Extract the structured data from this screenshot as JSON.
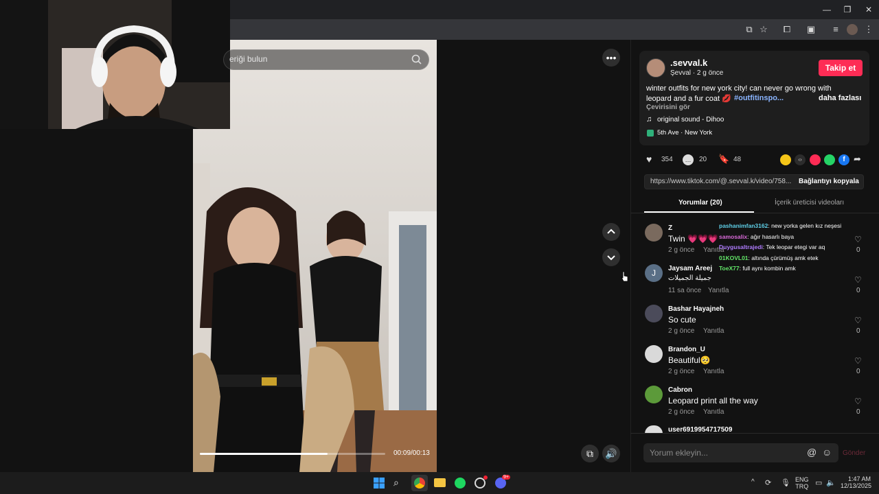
{
  "window": {
    "minimize": "—",
    "restore": "❐",
    "close": "✕"
  },
  "search": {
    "placeholder": "eriği bulun"
  },
  "video": {
    "time": "00:09/00:13",
    "progress": 0.69
  },
  "author": {
    "username": ".sevval.k",
    "display": "Şevval · 2 g önce",
    "follow": "Takip et",
    "caption_line1": "winter outfits for new york city! can never go wrong with",
    "caption_line2": "leopard and a fur coat 💋",
    "hashtag": "#outfitinspo...",
    "more": "daha fazlası",
    "translate": "Çevirisini gör",
    "sound": "original sound - Dihoo",
    "location": "5th Ave · New York"
  },
  "stats": {
    "likes": "354",
    "comments": "20",
    "saves": "48"
  },
  "link": {
    "url": "https://www.tiktok.com/@.sevval.k/video/758...",
    "copy": "Bağlantıyı kopyala"
  },
  "tabs": {
    "comments": "Yorumlar (20)",
    "creator": "İçerik üreticisi videoları"
  },
  "comments": [
    {
      "name": "Z",
      "text": "Twin 💗💗💗",
      "time": "2 g önce",
      "reply": "Yanıtla",
      "likes": "0"
    },
    {
      "name": "Jaysam Areej",
      "text": "جميلة الجميلات",
      "time": "11 sa önce",
      "reply": "Yanıtla",
      "likes": "0",
      "initial": "J"
    },
    {
      "name": "Bashar Hayajneh",
      "text": "So cute",
      "time": "2 g önce",
      "reply": "Yanıtla",
      "likes": "0"
    },
    {
      "name": "Brandon_U",
      "text": "Beautiful🥺",
      "time": "2 g önce",
      "reply": "Yanıtla",
      "likes": "0"
    },
    {
      "name": "Cabron",
      "text": "Leopard print all the way",
      "time": "2 g önce",
      "reply": "Yanıtla",
      "likes": "0"
    },
    {
      "name": "user6919954717509"
    }
  ],
  "chat": [
    {
      "name": "pashanimfan3162",
      "msg": ": new yorka gelen kız neşesi",
      "color": "#5fd0e8"
    },
    {
      "name": "samosalix",
      "msg": ": ağır hasarlı baya",
      "color": "#d86ad8"
    },
    {
      "name": "Duygusaltrajedi",
      "msg": ": Tek leopar etegi var aq",
      "color": "#b07cff"
    },
    {
      "name": "01KOVL01",
      "msg": ": altında çürümüş amk etek",
      "color": "#64e86a"
    },
    {
      "name": "ToeX77",
      "msg": ": full aynı kombin amk",
      "color": "#64e86a"
    }
  ],
  "comment_input": {
    "placeholder": "Yorum ekleyin...",
    "send": "Gönder"
  },
  "taskbar": {
    "lang1": "ENG",
    "lang2": "TRQ",
    "time": "1:47 AM",
    "date": "12/13/2025",
    "discord_badge": "9+"
  },
  "colors": {
    "accent": "#fe2c55",
    "hashtag": "#8ab4ff"
  }
}
